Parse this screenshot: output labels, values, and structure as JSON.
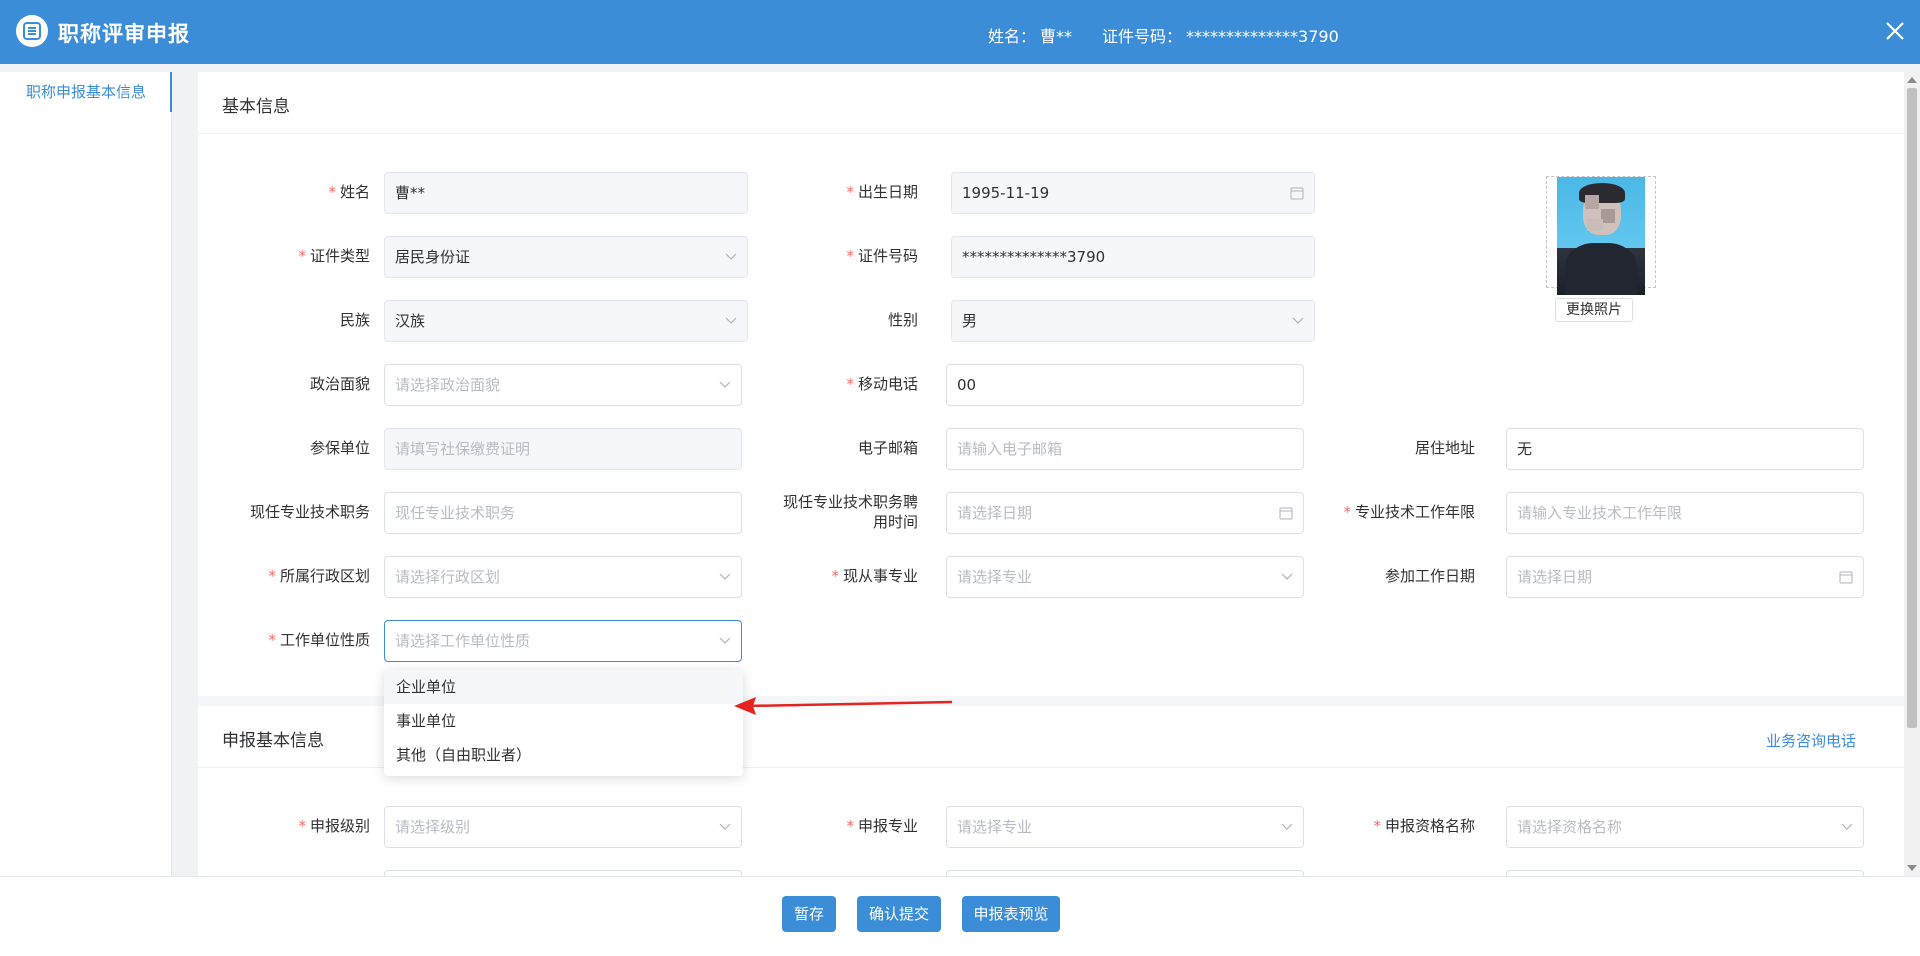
{
  "header": {
    "title": "职称评审申报",
    "name_label": "姓名：",
    "name_value": "曹**",
    "id_label": "证件号码：",
    "id_value": "**************3790"
  },
  "sidebar": {
    "items": [
      {
        "label": "职称申报基本信息"
      }
    ]
  },
  "section1": {
    "title": "基本信息"
  },
  "section2": {
    "title": "申报基本信息",
    "link": "业务咨询电话"
  },
  "fields": {
    "name": {
      "label": "姓名",
      "value": "曹**"
    },
    "birth": {
      "label": "出生日期",
      "value": "1995-11-19"
    },
    "id_type": {
      "label": "证件类型",
      "value": "居民身份证"
    },
    "id_no": {
      "label": "证件号码",
      "value": "**************3790"
    },
    "ethnic": {
      "label": "民族",
      "value": "汉族"
    },
    "gender": {
      "label": "性别",
      "value": "男"
    },
    "political": {
      "label": "政治面貌",
      "placeholder": "请选择政治面貌"
    },
    "mobile": {
      "label": "移动电话",
      "value": "00"
    },
    "insured": {
      "label": "参保单位",
      "placeholder": "请填写社保缴费证明"
    },
    "email": {
      "label": "电子邮箱",
      "placeholder": "请输入电子邮箱"
    },
    "address": {
      "label": "居住地址",
      "value": "无"
    },
    "position": {
      "label": "现任专业技术职务",
      "placeholder": "现任专业技术职务"
    },
    "hire_time": {
      "label_line1": "现任专业技术职务聘",
      "label_line2": "用时间",
      "placeholder": "请选择日期"
    },
    "work_years": {
      "label": "专业技术工作年限",
      "placeholder": "请输入专业技术工作年限"
    },
    "region": {
      "label": "所属行政区划",
      "placeholder": "请选择行政区划"
    },
    "major": {
      "label": "现从事专业",
      "placeholder": "请选择专业"
    },
    "work_date": {
      "label": "参加工作日期",
      "placeholder": "请选择日期"
    },
    "unit_type": {
      "label": "工作单位性质",
      "placeholder": "请选择工作单位性质"
    },
    "apply_level": {
      "label": "申报级别",
      "placeholder": "请选择级别"
    },
    "apply_major": {
      "label": "申报专业",
      "placeholder": "请选择专业"
    },
    "qual_name": {
      "label": "申报资格名称",
      "placeholder": "请选择资格名称"
    }
  },
  "photo": {
    "button": "更换照片"
  },
  "dropdown": {
    "options": [
      "企业单位",
      "事业单位",
      "其他（自由职业者）"
    ]
  },
  "footer": {
    "save": "暂存",
    "submit": "确认提交",
    "preview": "申报表预览"
  },
  "colors": {
    "primary": "#3c8dd8",
    "required": "#f56c6c",
    "arrow": "#e52421"
  }
}
